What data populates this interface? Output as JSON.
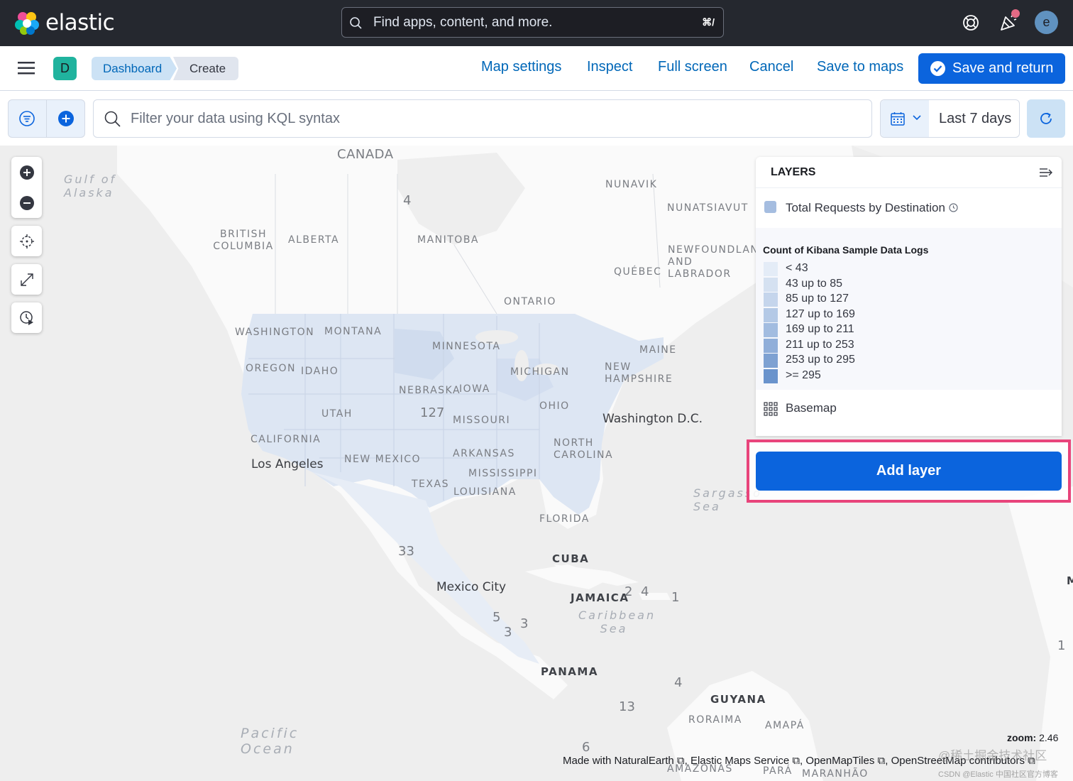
{
  "header": {
    "logo_text": "elastic",
    "search_placeholder": "Find apps, content, and more.",
    "search_shortcut": "⌘/",
    "avatar_initial": "e"
  },
  "nav": {
    "space_initial": "D",
    "breadcrumbs": [
      "Dashboard",
      "Create"
    ],
    "links": [
      "Map settings",
      "Inspect",
      "Full screen",
      "Cancel",
      "Save to maps"
    ],
    "primary_action": "Save and return"
  },
  "query": {
    "placeholder": "Filter your data using KQL syntax",
    "date_range": "Last 7 days"
  },
  "map": {
    "labels": {
      "canada": "CANADA",
      "gulf_alaska": "Gulf of Alaska",
      "nunavik": "NUNAVIK",
      "nunatsiavut": "NUNATSIAVUT",
      "british_columbia": "BRITISH COLUMBIA",
      "alberta": "ALBERTA",
      "manitoba": "MANITOBA",
      "newfoundland": "NEWFOUNDLAND AND LABRADOR",
      "quebec": "QUÉBEC",
      "ontario": "ONTARIO",
      "washington": "WASHINGTON",
      "montana": "MONTANA",
      "minnesota": "MINNESOTA",
      "maine": "MAINE",
      "oregon": "OREGON",
      "idaho": "IDAHO",
      "michigan": "MICHIGAN",
      "new_hampshire": "NEW HAMPSHIRE",
      "nebraska": "NEBRASKA",
      "iowa": "IOWA",
      "utah": "UTAH",
      "ohio": "OHIO",
      "missouri": "MISSOURI",
      "washington_dc": "Washington D.C.",
      "california": "CALIFORNIA",
      "north_carolina": "NORTH CAROLINA",
      "arkansas": "ARKANSAS",
      "los_angeles": "Los Angeles",
      "new_mexico": "NEW MEXICO",
      "mississippi": "MISSISSIPPI",
      "texas": "TEXAS",
      "louisiana": "LOUISIANA",
      "sargasso": "Sargasso Sea",
      "florida": "FLORIDA",
      "cuba": "CUBA",
      "mexico_city": "Mexico City",
      "jamaica": "JAMAICA",
      "caribbean": "Caribbean Sea",
      "panama": "PANAMA",
      "guyana": "GUYANA",
      "roraima": "RORAIMA",
      "amapa": "AMAPÁ",
      "pacific": "Pacific Ocean",
      "amazonas": "AMAZONAS",
      "para": "PARÁ",
      "maranhao": "MARANHÃO",
      "edge_m": "M"
    },
    "counts": {
      "c4a": "4",
      "c127": "127",
      "c33": "33",
      "c2": "2",
      "c4b": "4",
      "c1a": "1",
      "c5": "5",
      "c3a": "3",
      "c3b": "3",
      "c4c": "4",
      "c13": "13",
      "c6": "6",
      "c1b": "1"
    },
    "zoom_label": "zoom:",
    "zoom_value": "2.46",
    "attribution": "Made with NaturalEarth ⧉, Elastic Maps Service ⧉, OpenMapTiles ⧉, OpenStreetMap contributors ⧉"
  },
  "layers_panel": {
    "title": "LAYERS",
    "layer_name": "Total Requests by Destination",
    "legend_title": "Count of Kibana Sample Data Logs",
    "legend": [
      {
        "label": "< 43",
        "color": "#e4ecf7"
      },
      {
        "label": "43 up to 85",
        "color": "#d5e1f1"
      },
      {
        "label": "85 up to 127",
        "color": "#c5d5ec"
      },
      {
        "label": "127 up to 169",
        "color": "#b4c9e6"
      },
      {
        "label": "169 up to 211",
        "color": "#a2bce0"
      },
      {
        "label": "211 up to 253",
        "color": "#90aed9"
      },
      {
        "label": "253 up to 295",
        "color": "#7ea1d2"
      },
      {
        "label": ">= 295",
        "color": "#6a93cc"
      }
    ],
    "basemap": "Basemap",
    "add_layer": "Add layer"
  },
  "watermark": {
    "line1": "@稀土掘金技术社区",
    "line2": "CSDN @Elastic 中国社区官方博客"
  }
}
